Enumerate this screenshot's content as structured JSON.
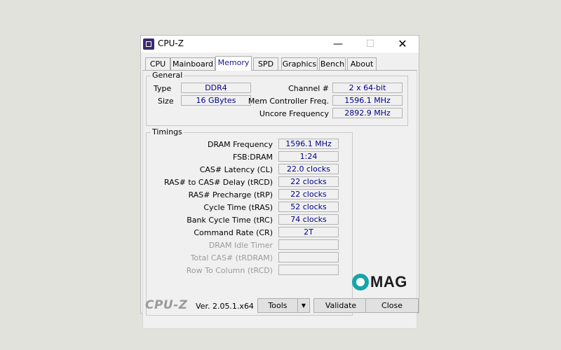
{
  "window": {
    "title": "CPU-Z"
  },
  "titlebar_buttons": {
    "minimize": "—",
    "maximize": "☐",
    "close": "✕"
  },
  "tabs": [
    {
      "label": "CPU"
    },
    {
      "label": "Mainboard"
    },
    {
      "label": "Memory"
    },
    {
      "label": "SPD"
    },
    {
      "label": "Graphics"
    },
    {
      "label": "Bench"
    },
    {
      "label": "About"
    }
  ],
  "active_tab": "Memory",
  "general": {
    "title": "General",
    "type_label": "Type",
    "type_value": "DDR4",
    "size_label": "Size",
    "size_value": "16 GBytes",
    "channel_label": "Channel #",
    "channel_value": "2 x 64-bit",
    "mem_ctrl_label": "Mem Controller Freq.",
    "mem_ctrl_value": "1596.1 MHz",
    "uncore_label": "Uncore Frequency",
    "uncore_value": "2892.9 MHz"
  },
  "timings": {
    "title": "Timings",
    "rows": [
      {
        "label": "DRAM Frequency",
        "value": "1596.1 MHz"
      },
      {
        "label": "FSB:DRAM",
        "value": "1:24"
      },
      {
        "label": "CAS# Latency (CL)",
        "value": "22.0 clocks"
      },
      {
        "label": "RAS# to CAS# Delay (tRCD)",
        "value": "22 clocks"
      },
      {
        "label": "RAS# Precharge (tRP)",
        "value": "22 clocks"
      },
      {
        "label": "Cycle Time (tRAS)",
        "value": "52 clocks"
      },
      {
        "label": "Bank Cycle Time (tRC)",
        "value": "74 clocks"
      },
      {
        "label": "Command Rate (CR)",
        "value": "2T"
      },
      {
        "label": "DRAM Idle Timer",
        "value": ""
      },
      {
        "label": "Total CAS# (tRDRAM)",
        "value": ""
      },
      {
        "label": "Row To Column (tRCD)",
        "value": ""
      }
    ]
  },
  "footer": {
    "brand": "CPU-Z",
    "version": "Ver. 2.05.1.x64",
    "tools_label": "Tools",
    "validate_label": "Validate",
    "close_label": "Close"
  },
  "watermark": {
    "text": "MAG"
  },
  "colors": {
    "value_text": "#00008b",
    "active_tab_text": "#1a1a8c",
    "watermark_accent": "#15a5a8"
  }
}
